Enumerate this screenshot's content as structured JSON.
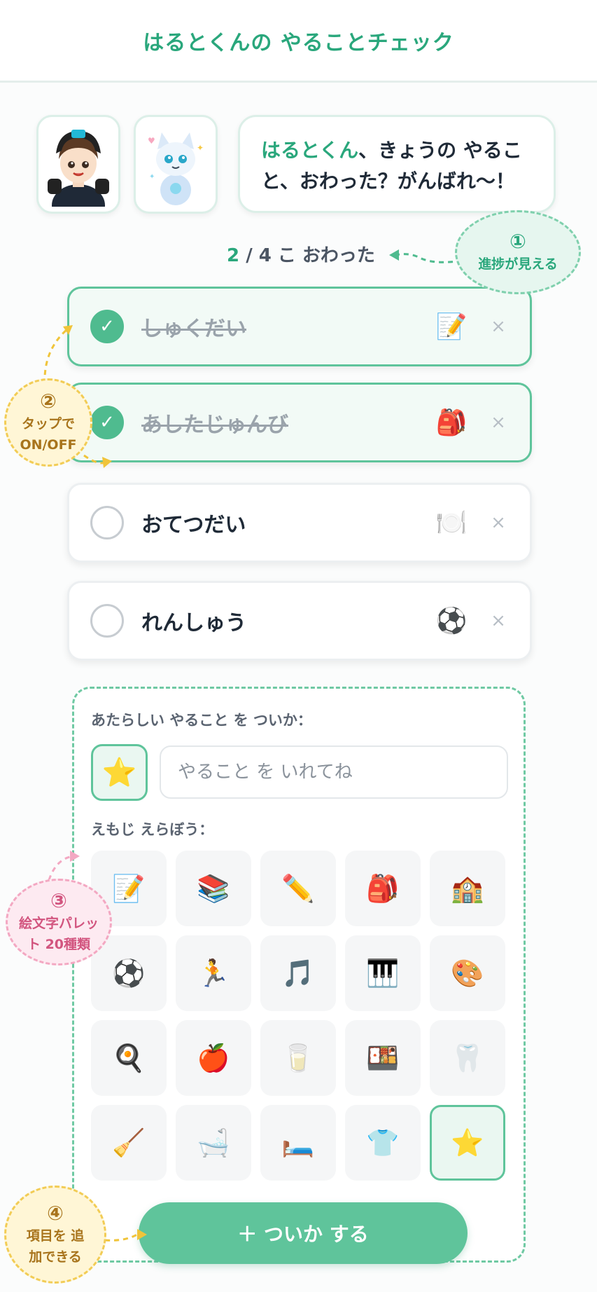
{
  "header": {
    "title": "はるとくんの やることチェック"
  },
  "speech": {
    "name": "はるとくん",
    "message": "、きょうの やること、おわった？がんばれ〜！"
  },
  "progress": {
    "done": "2",
    "rest": " / 4 こ おわった"
  },
  "tasks": [
    {
      "label": "しゅくだい",
      "emoji": "📝",
      "done": true,
      "delete": "×"
    },
    {
      "label": "あしたじゅんび",
      "emoji": "🎒",
      "done": true,
      "delete": "×"
    },
    {
      "label": "おてつだい",
      "emoji": "🍽️",
      "done": false,
      "delete": "×"
    },
    {
      "label": "れんしゅう",
      "emoji": "⚽",
      "done": false,
      "delete": "×"
    }
  ],
  "check_mark": "✓",
  "add_panel": {
    "title": "あたらしい やること を ついか：",
    "selected_emoji": "⭐",
    "input_placeholder": "やること を いれてね",
    "input_value": "",
    "palette_label": "えもじ えらぼう：",
    "emojis": [
      "📝",
      "📚",
      "✏️",
      "🎒",
      "🏫",
      "⚽",
      "🏃",
      "🎵",
      "🎹",
      "🎨",
      "🍳",
      "🍎",
      "🥛",
      "🍱",
      "🦷",
      "🧹",
      "🛁",
      "🛏️",
      "👕",
      "⭐"
    ],
    "selected_index": 19,
    "button_label": "＋ ついか する"
  },
  "callouts": [
    {
      "number": "①",
      "text": "進捗が見える"
    },
    {
      "number": "②",
      "text": "タップで ON/OFF"
    },
    {
      "number": "③",
      "text": "絵文字パレット 20種類"
    },
    {
      "number": "④",
      "text": "項目を 追加できる"
    }
  ],
  "colors": {
    "accent": "#2aa77c",
    "button": "#5fc49b",
    "done_bg": "#f2faf6"
  }
}
